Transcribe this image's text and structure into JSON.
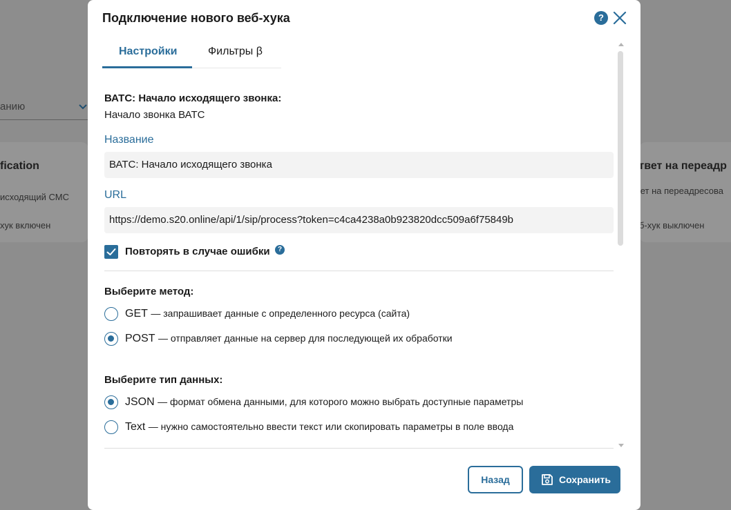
{
  "background": {
    "select_text": "анию",
    "left_card": {
      "title": "fication",
      "line1": "исходящий СМС",
      "line2": "хук включен"
    },
    "right_card": {
      "title": "ответ на переадр",
      "line1": "вет на переадресова",
      "line2": "б-хук выключен"
    }
  },
  "modal": {
    "title": "Подключение нового веб-хука",
    "tabs": [
      {
        "label": "Настройки",
        "active": true
      },
      {
        "label": "Фильтры β",
        "active": false
      }
    ],
    "event": {
      "label": "ВАТС: Начало исходящего звонка:",
      "value": "Начало звонка ВАТС"
    },
    "name_field": {
      "label": "Название",
      "value": "ВАТС: Начало исходящего звонка"
    },
    "url_field": {
      "label": "URL",
      "value": "https://demo.s20.online/api/1/sip/process?token=c4ca4238a0b923820dcc509a6f75849b"
    },
    "retry_checkbox": {
      "label": "Повторять в случае ошибки",
      "checked": true
    },
    "method": {
      "title": "Выберите метод:",
      "options": [
        {
          "name": "GET",
          "desc": "— запрашивает данные с определенного ресурса (сайта)",
          "checked": false
        },
        {
          "name": "POST",
          "desc": "— отправляет данные на сервер для последующей их обработки",
          "checked": true
        }
      ]
    },
    "data_type": {
      "title": "Выберите тип данных:",
      "options": [
        {
          "name": "JSON",
          "desc": "— формат обмена данными, для которого можно выбрать доступные параметры",
          "checked": true
        },
        {
          "name": "Text",
          "desc": "— нужно самостоятельно ввести текст или скопировать параметры в поле ввода",
          "checked": false
        }
      ]
    },
    "buttons": {
      "back": "Назад",
      "save": "Сохранить"
    }
  },
  "colors": {
    "accent": "#2a6d9a",
    "overlay": "#8d8d8d",
    "input_bg": "#f3f3f3"
  }
}
